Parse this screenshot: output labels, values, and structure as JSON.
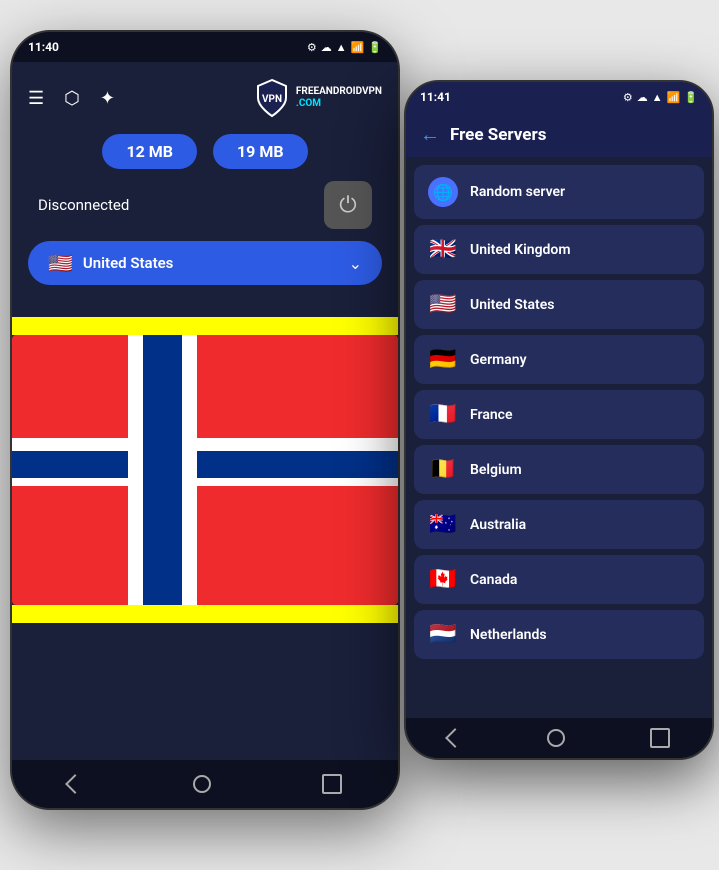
{
  "phone_left": {
    "time": "11:40",
    "stats": {
      "download": "12 MB",
      "upload": "19 MB"
    },
    "status": "Disconnected",
    "country": {
      "name": "United States",
      "flag": "🇺🇸"
    },
    "toolbar": {
      "menu_icon": "☰",
      "share_icon": "⬡",
      "star_icon": "✦"
    },
    "logo": {
      "text_main": "FREEANDROIDVPN",
      "text_sub": ".COM"
    }
  },
  "phone_right": {
    "time": "11:41",
    "header": {
      "title": "Free Servers",
      "back_label": "←"
    },
    "servers": [
      {
        "name": "Random server",
        "flag": "🌐",
        "is_globe": true
      },
      {
        "name": "United Kingdom",
        "flag": "🇬🇧"
      },
      {
        "name": "United States",
        "flag": "🇺🇸"
      },
      {
        "name": "Germany",
        "flag": "🇩🇪"
      },
      {
        "name": "France",
        "flag": "🇫🇷"
      },
      {
        "name": "Belgium",
        "flag": "🇧🇪"
      },
      {
        "name": "Australia",
        "flag": "🇦🇺"
      },
      {
        "name": "Canada",
        "flag": "🇨🇦"
      },
      {
        "name": "Netherlands",
        "flag": "🇳🇱"
      }
    ]
  }
}
